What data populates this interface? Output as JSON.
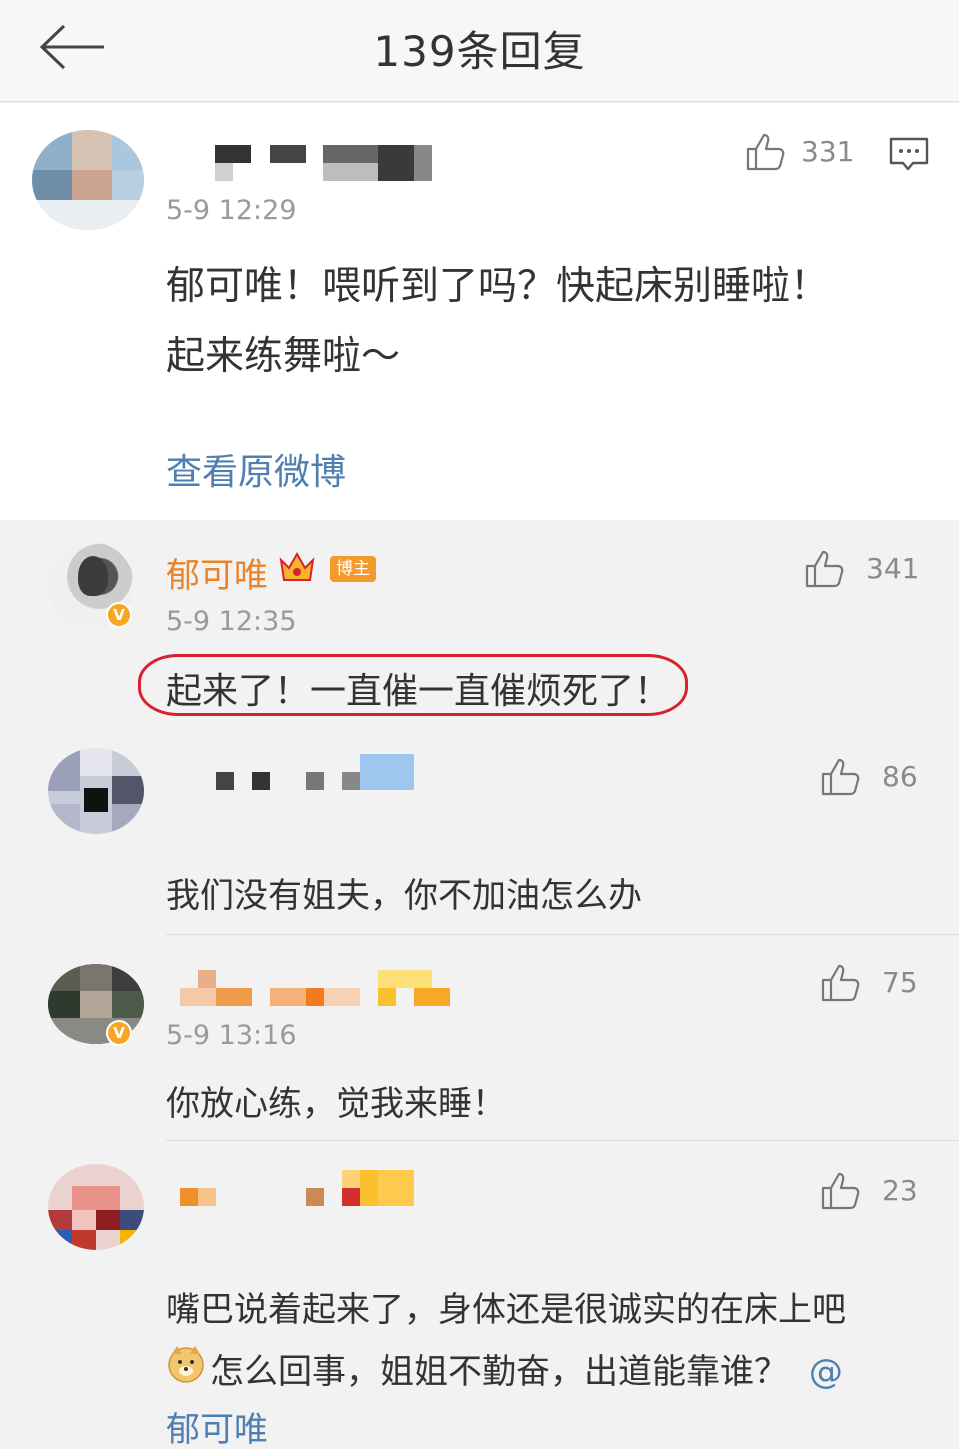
{
  "header": {
    "title": "139条回复"
  },
  "main_comment": {
    "time": "5-9 12:29",
    "likes": "331",
    "text_line1": "郁可唯！喂听到了吗？快起床别睡啦！",
    "text_line2": "起来练舞啦～",
    "view_original": "查看原微博"
  },
  "replies": [
    {
      "author": "郁可唯",
      "badge": "博主",
      "time": "5-9 12:35",
      "likes": "341",
      "text": "起来了！一直催一直催烦死了！"
    },
    {
      "likes": "86",
      "text": "我们没有姐夫，你不加油怎么办"
    },
    {
      "time": "5-9 13:16",
      "likes": "75",
      "text": "你放心练，觉我来睡！"
    },
    {
      "likes": "23",
      "text_line1": "嘴巴说着起来了，身体还是很诚实的在床上吧",
      "text_line2": "怎么回事，姐姐不勤奋，出道能靠谁？",
      "mention_at": "@",
      "mention_name": "郁可唯"
    }
  ],
  "icons": {
    "back": "arrow-left-icon",
    "like": "thumbs-up-icon",
    "comment": "comment-bubble-icon",
    "crown": "crown-icon",
    "verified": "verified-v-icon",
    "emoji": "doge-emoji-icon"
  },
  "colors": {
    "author_orange": "#e8842c",
    "link_blue": "#4f7fb0",
    "highlight_red": "#d8202e"
  }
}
